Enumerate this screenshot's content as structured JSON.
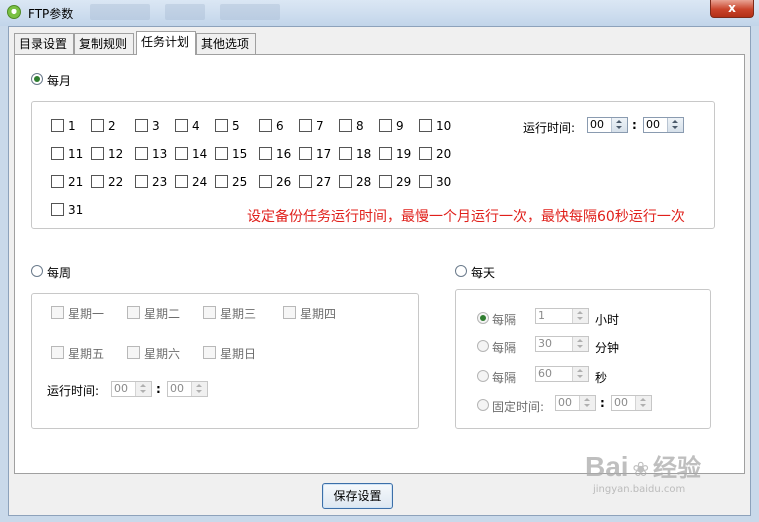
{
  "window": {
    "title": "FTP参数",
    "close_glyph": "x"
  },
  "tabs": [
    "目录设置",
    "复制规则",
    "任务计划",
    "其他选项"
  ],
  "monthly": {
    "label": "每月",
    "days": [
      "1",
      "2",
      "3",
      "4",
      "5",
      "6",
      "7",
      "8",
      "9",
      "10",
      "11",
      "12",
      "13",
      "14",
      "15",
      "16",
      "17",
      "18",
      "19",
      "20",
      "21",
      "22",
      "23",
      "24",
      "25",
      "26",
      "27",
      "28",
      "29",
      "30",
      "31"
    ],
    "run_time_label": "运行时间:",
    "hour": "00",
    "minute": "00"
  },
  "annotation": "设定备份任务运行时间，最慢一个月运行一次，最快每隔60秒运行一次",
  "weekly": {
    "label": "每周",
    "weekdays": [
      "星期一",
      "星期二",
      "星期三",
      "星期四",
      "星期五",
      "星期六",
      "星期日"
    ],
    "run_time_label": "运行时间:",
    "hour": "00",
    "minute": "00"
  },
  "daily": {
    "label": "每天",
    "every_label": "每隔",
    "hours_value": "1",
    "hours_unit": "小时",
    "minutes_value": "30",
    "minutes_unit": "分钟",
    "seconds_value": "60",
    "seconds_unit": "秒",
    "fixed_time_label": "固定时间:",
    "fixed_hour": "00",
    "fixed_minute": "00"
  },
  "save_button": "保存设置",
  "watermark": {
    "main": "Bai",
    "mark": "经验",
    "sub": "jingyan.baidu.com"
  }
}
